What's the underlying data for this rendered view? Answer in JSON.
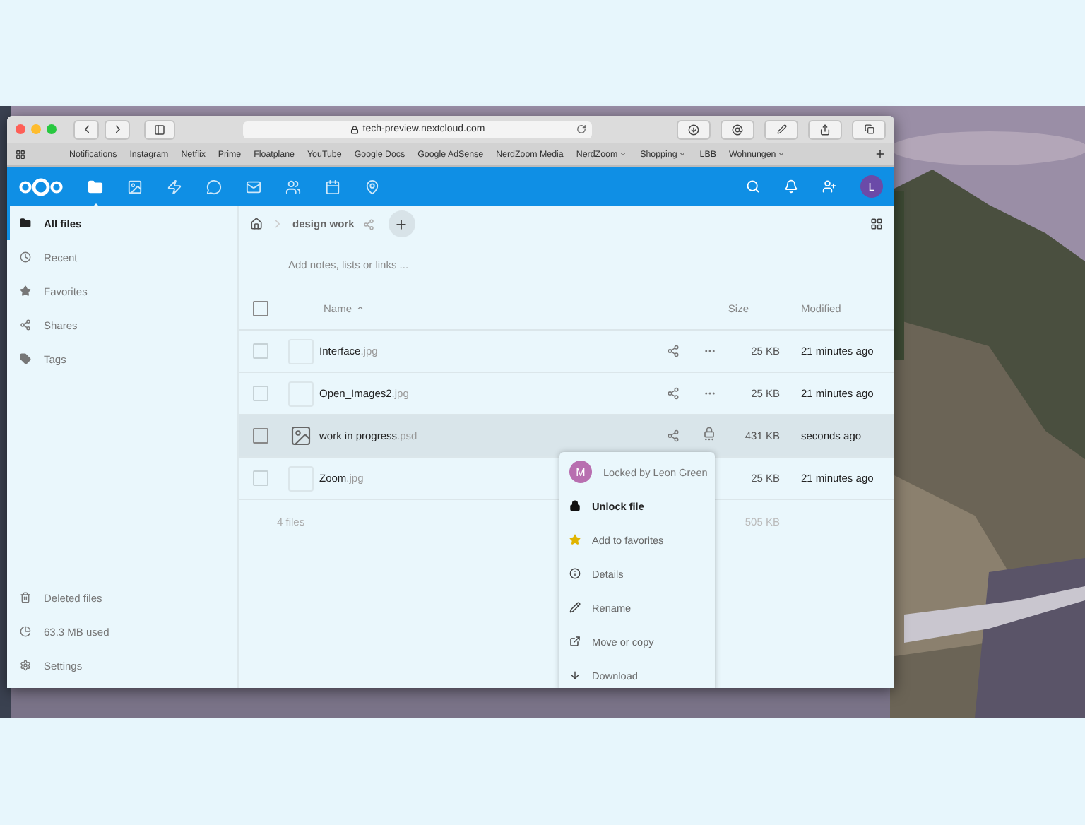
{
  "browser": {
    "url": "tech-preview.nextcloud.com",
    "bookmarks": [
      {
        "label": "Notifications",
        "has_menu": false
      },
      {
        "label": "Instagram",
        "has_menu": false
      },
      {
        "label": "Netflix",
        "has_menu": false
      },
      {
        "label": "Prime",
        "has_menu": false
      },
      {
        "label": "Floatplane",
        "has_menu": false
      },
      {
        "label": "YouTube",
        "has_menu": false
      },
      {
        "label": "Google Docs",
        "has_menu": false
      },
      {
        "label": "Google AdSense",
        "has_menu": false
      },
      {
        "label": "NerdZoom Media",
        "has_menu": false
      },
      {
        "label": "NerdZoom",
        "has_menu": true
      },
      {
        "label": "Shopping",
        "has_menu": true
      },
      {
        "label": "LBB",
        "has_menu": false
      },
      {
        "label": "Wohnungen",
        "has_menu": true
      }
    ]
  },
  "header": {
    "avatar": "L"
  },
  "sidebar": {
    "items": [
      {
        "label": "All files",
        "selected": true
      },
      {
        "label": "Recent",
        "selected": false
      },
      {
        "label": "Favorites",
        "selected": false
      },
      {
        "label": "Shares",
        "selected": false
      },
      {
        "label": "Tags",
        "selected": false
      }
    ],
    "footer": [
      "Deleted files",
      "63.3 MB used",
      "Settings"
    ]
  },
  "breadcrumb": {
    "folder": "design work"
  },
  "notes": {
    "placeholder": "Add notes, lists or links ..."
  },
  "table": {
    "columns": [
      "Name",
      "Size",
      "Modified"
    ],
    "all_checked": false,
    "rows": [
      {
        "name": "Interface",
        "extension": ".jpg",
        "size": "25 KB",
        "modified": "21 minutes ago",
        "checked": false,
        "selected": false,
        "preview": false,
        "locked": false
      },
      {
        "name": "Open_Images2",
        "extension": ".jpg",
        "size": "25 KB",
        "modified": "21 minutes ago",
        "checked": false,
        "selected": false,
        "preview": false,
        "locked": false
      },
      {
        "name": "work in progress",
        "extension": ".psd",
        "size": "431 KB",
        "modified": "seconds ago",
        "checked": false,
        "selected": true,
        "preview": true,
        "locked": true
      },
      {
        "name": "Zoom",
        "extension": ".jpg",
        "size": "25 KB",
        "modified": "21 minutes ago",
        "checked": false,
        "selected": false,
        "preview": false,
        "locked": false
      }
    ],
    "summary": {
      "count": "4 files",
      "size": "505 KB"
    }
  },
  "menu": {
    "lock_avatar": "M",
    "lock_text": "Locked by Leon Green",
    "items": [
      {
        "label": "Unlock file",
        "hovered": true
      },
      {
        "label": "Add to favorites",
        "hovered": false
      },
      {
        "label": "Details",
        "hovered": false
      },
      {
        "label": "Rename",
        "hovered": false
      },
      {
        "label": "Move or copy",
        "hovered": false
      },
      {
        "label": "Download",
        "hovered": false
      }
    ]
  }
}
